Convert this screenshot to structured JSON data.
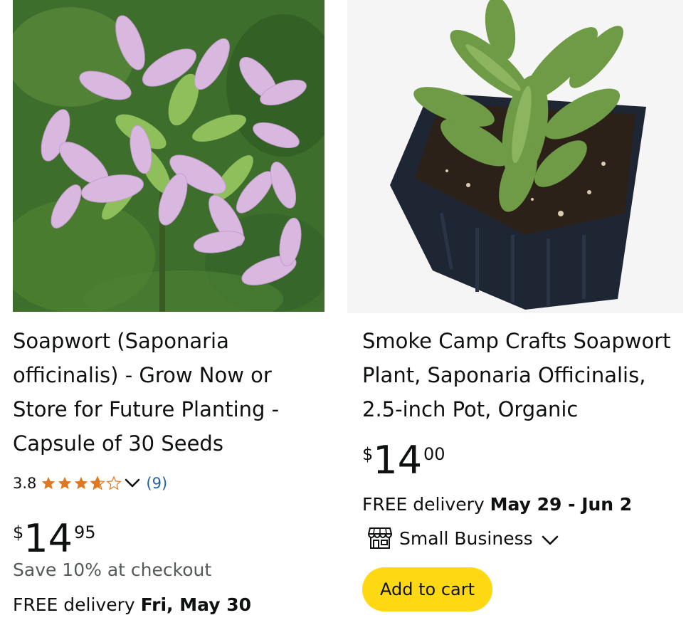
{
  "products": [
    {
      "image_alt": "",
      "title": "Soapwort (Saponaria officinalis) - Grow Now or Store for Future Planting - Capsule of 30 Seeds",
      "rating": "3.8",
      "rating_stars": 3.8,
      "review_count": "(9)",
      "price_symbol": "$",
      "price_whole": "14",
      "price_fraction": "95",
      "save_text": "Save 10% at checkout",
      "delivery_prefix": "FREE delivery ",
      "delivery_date": "Fri, May 30"
    },
    {
      "image_alt": "",
      "title": "Smoke Camp Crafts Soapwort Plant, Saponaria Officinalis, 2.5-inch Pot, Organic",
      "price_symbol": "$",
      "price_whole": "14",
      "price_fraction": "00",
      "delivery_prefix": "FREE delivery ",
      "delivery_date": "May 29 - Jun 2",
      "badge": "Small Business",
      "button_label": "Add to cart"
    }
  ],
  "colors": {
    "star": "#de7921",
    "link": "#2162a1",
    "button": "#ffd814",
    "muted": "#565959",
    "text": "#0f1111"
  },
  "icons": [
    "star-icon",
    "chevron-down-icon",
    "store-icon"
  ]
}
